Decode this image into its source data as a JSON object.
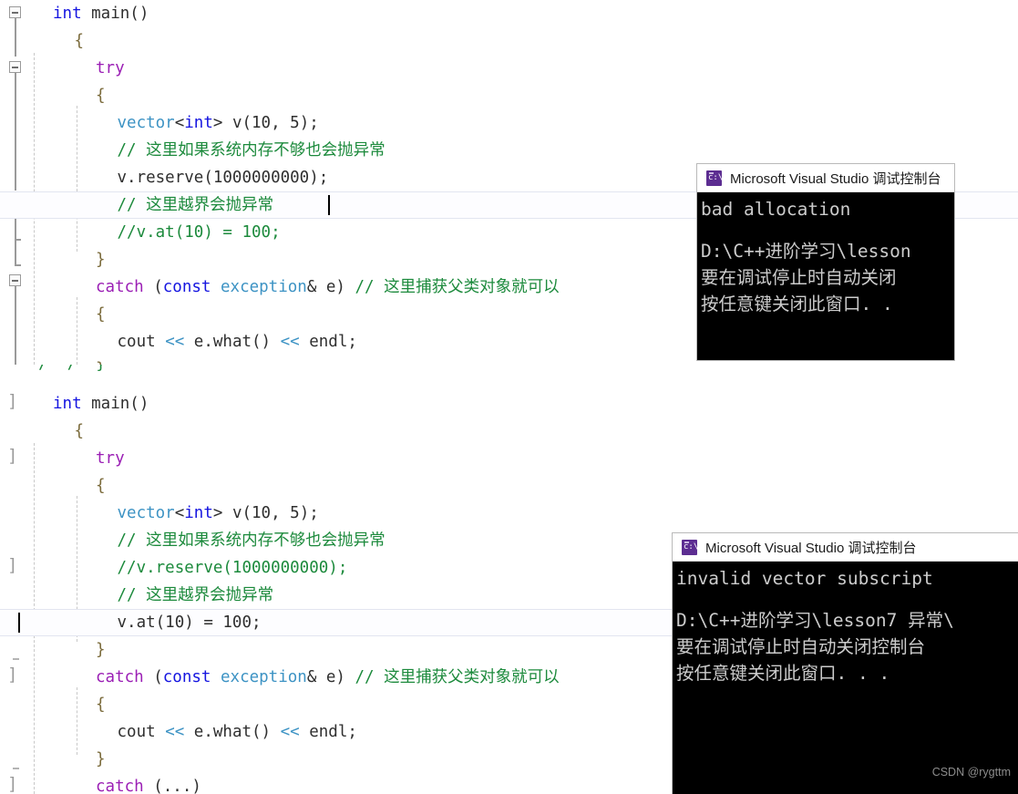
{
  "editor_top": {
    "lines": [
      {
        "indent": 0,
        "tokens": [
          {
            "c": "t-key",
            "t": "int"
          },
          {
            "c": "t-plain",
            "t": " main()"
          }
        ]
      },
      {
        "indent": 1,
        "tokens": [
          {
            "c": "t-brace",
            "t": "{"
          }
        ]
      },
      {
        "indent": 2,
        "tokens": [
          {
            "c": "t-kw2",
            "t": "try"
          }
        ]
      },
      {
        "indent": 2,
        "tokens": [
          {
            "c": "t-brace",
            "t": "{"
          }
        ]
      },
      {
        "indent": 3,
        "tokens": [
          {
            "c": "t-type",
            "t": "vector"
          },
          {
            "c": "t-punct",
            "t": "<"
          },
          {
            "c": "t-key",
            "t": "int"
          },
          {
            "c": "t-punct",
            "t": "> v(10, 5);"
          }
        ]
      },
      {
        "indent": 3,
        "tokens": [
          {
            "c": "t-comment",
            "t": "// 这里如果系统内存不够也会抛异常"
          }
        ]
      },
      {
        "indent": 3,
        "tokens": [
          {
            "c": "t-plain",
            "t": "v.reserve(1000000000);"
          }
        ]
      },
      {
        "indent": 3,
        "tokens": [
          {
            "c": "t-comment",
            "t": "// 这里越界会抛异常"
          }
        ],
        "current": true
      },
      {
        "indent": 3,
        "tokens": [
          {
            "c": "t-comment",
            "t": "//v.at(10) = 100;"
          }
        ]
      },
      {
        "indent": 2,
        "tokens": [
          {
            "c": "t-brace",
            "t": "}"
          }
        ]
      },
      {
        "indent": 2,
        "tokens": [
          {
            "c": "t-kw2",
            "t": "catch"
          },
          {
            "c": "t-punct",
            "t": " ("
          },
          {
            "c": "t-key",
            "t": "const"
          },
          {
            "c": "t-punct",
            "t": " "
          },
          {
            "c": "t-type",
            "t": "exception"
          },
          {
            "c": "t-punct",
            "t": "& e) "
          },
          {
            "c": "t-comment",
            "t": "// 这里捕获父类对象就可以"
          }
        ]
      },
      {
        "indent": 2,
        "tokens": [
          {
            "c": "t-brace",
            "t": "{"
          }
        ]
      },
      {
        "indent": 3,
        "tokens": [
          {
            "c": "t-plain",
            "t": "cout "
          },
          {
            "c": "t-type",
            "t": "<<"
          },
          {
            "c": "t-plain",
            "t": " e.what() "
          },
          {
            "c": "t-type",
            "t": "<<"
          },
          {
            "c": "t-plain",
            "t": " endl;"
          }
        ]
      },
      {
        "indent": 2,
        "tokens": [
          {
            "c": "t-brace",
            "t": "}"
          }
        ]
      }
    ]
  },
  "clip_strip": {
    "tokens": [
      {
        "c": "t-comment",
        "t": "    /  /  }"
      }
    ]
  },
  "editor_bottom": {
    "lines": [
      {
        "indent": 0,
        "tokens": [
          {
            "c": "t-key",
            "t": "int"
          },
          {
            "c": "t-plain",
            "t": " main()"
          }
        ]
      },
      {
        "indent": 1,
        "tokens": [
          {
            "c": "t-brace",
            "t": "{"
          }
        ]
      },
      {
        "indent": 2,
        "tokens": [
          {
            "c": "t-kw2",
            "t": "try"
          }
        ]
      },
      {
        "indent": 2,
        "tokens": [
          {
            "c": "t-brace",
            "t": "{"
          }
        ]
      },
      {
        "indent": 3,
        "tokens": [
          {
            "c": "t-type",
            "t": "vector"
          },
          {
            "c": "t-punct",
            "t": "<"
          },
          {
            "c": "t-key",
            "t": "int"
          },
          {
            "c": "t-punct",
            "t": "> v(10, 5);"
          }
        ]
      },
      {
        "indent": 3,
        "tokens": [
          {
            "c": "t-comment",
            "t": "// 这里如果系统内存不够也会抛异常"
          }
        ]
      },
      {
        "indent": 3,
        "tokens": [
          {
            "c": "t-comment",
            "t": "//v.reserve(1000000000);"
          }
        ]
      },
      {
        "indent": 3,
        "tokens": [
          {
            "c": "t-comment",
            "t": "// 这里越界会抛异常"
          }
        ]
      },
      {
        "indent": 3,
        "tokens": [
          {
            "c": "t-plain",
            "t": "v.at(10) = 100;"
          }
        ],
        "current": true
      },
      {
        "indent": 2,
        "tokens": [
          {
            "c": "t-brace",
            "t": "}"
          }
        ]
      },
      {
        "indent": 2,
        "tokens": [
          {
            "c": "t-kw2",
            "t": "catch"
          },
          {
            "c": "t-punct",
            "t": " ("
          },
          {
            "c": "t-key",
            "t": "const"
          },
          {
            "c": "t-punct",
            "t": " "
          },
          {
            "c": "t-type",
            "t": "exception"
          },
          {
            "c": "t-punct",
            "t": "& e) "
          },
          {
            "c": "t-comment",
            "t": "// 这里捕获父类对象就可以"
          }
        ]
      },
      {
        "indent": 2,
        "tokens": [
          {
            "c": "t-brace",
            "t": "{"
          }
        ]
      },
      {
        "indent": 3,
        "tokens": [
          {
            "c": "t-plain",
            "t": "cout "
          },
          {
            "c": "t-type",
            "t": "<<"
          },
          {
            "c": "t-plain",
            "t": " e.what() "
          },
          {
            "c": "t-type",
            "t": "<<"
          },
          {
            "c": "t-plain",
            "t": " endl;"
          }
        ]
      },
      {
        "indent": 2,
        "tokens": [
          {
            "c": "t-brace",
            "t": "}"
          }
        ]
      },
      {
        "indent": 2,
        "tokens": [
          {
            "c": "t-kw2",
            "t": "catch"
          },
          {
            "c": "t-punct",
            "t": " (...)"
          }
        ]
      }
    ]
  },
  "console_top": {
    "title": "Microsoft Visual Studio 调试控制台",
    "icon": "console-app-icon",
    "lines": [
      "bad allocation",
      "",
      "D:\\C++进阶学习\\lesson",
      "要在调试停止时自动关闭",
      "按任意键关闭此窗口. ."
    ]
  },
  "console_bottom": {
    "title": "Microsoft Visual Studio 调试控制台",
    "icon": "console-app-icon",
    "lines": [
      "invalid vector subscript",
      "",
      "D:\\C++进阶学习\\lesson7 异常\\",
      "要在调试停止时自动关闭控制台",
      "按任意键关闭此窗口. . ."
    ]
  },
  "watermark": {
    "text": "CSDN @rygttm"
  },
  "colors": {
    "keyword": "#1515e0",
    "control_keyword": "#9b1fb5",
    "type": "#3d93c4",
    "comment": "#1c8a3c",
    "plain": "#2f2f2f",
    "console_bg": "#000000",
    "console_fg": "#cccccc",
    "icon_purple": "#5c2d91"
  }
}
